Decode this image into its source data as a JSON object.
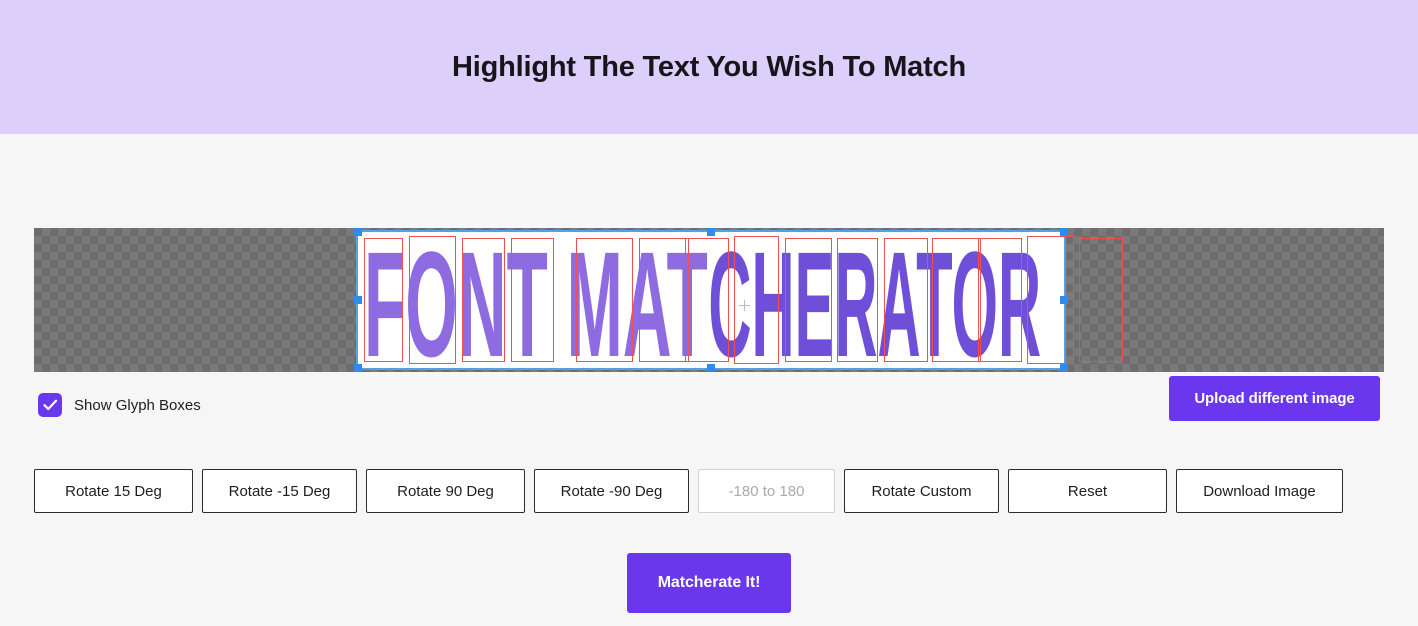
{
  "header": {
    "title": "Highlight The Text You Wish To Match",
    "background_color": "#DCCFFB"
  },
  "colors": {
    "page_background": "#F6F6F7",
    "accent_purple": "#6A36EE",
    "selection_border": "#54A0E8",
    "selection_handle": "#2F8BEC",
    "glyph_box": "#F05050",
    "artwork_light_purple": "#8E6BE0",
    "artwork_dark_purple": "#6F4FD8",
    "checker_dark": "#6D6D6D",
    "checker_light": "#7A7A7A"
  },
  "canvas": {
    "artwork_text": "FONT MATCHERATOR",
    "letters": [
      "F",
      "O",
      "N",
      "T",
      "M",
      "A",
      "T",
      "C",
      "H",
      "E",
      "R",
      "A",
      "T",
      "O",
      "R"
    ],
    "selection_active": true,
    "checkerboard": "transparency-checkerboard"
  },
  "controls": {
    "show_glyph_boxes": {
      "label": "Show Glyph Boxes",
      "checked": true
    },
    "upload_button": "Upload different image"
  },
  "toolbar": {
    "rotate_15": "Rotate 15 Deg",
    "rotate_minus_15": "Rotate -15 Deg",
    "rotate_90": "Rotate 90 Deg",
    "rotate_minus_90": "Rotate -90 Deg",
    "custom_angle_value": "",
    "custom_angle_placeholder": "-180 to 180",
    "rotate_custom": "Rotate Custom",
    "reset": "Reset",
    "download_image": "Download Image"
  },
  "footer": {
    "matcherate_button": "Matcherate It!"
  }
}
